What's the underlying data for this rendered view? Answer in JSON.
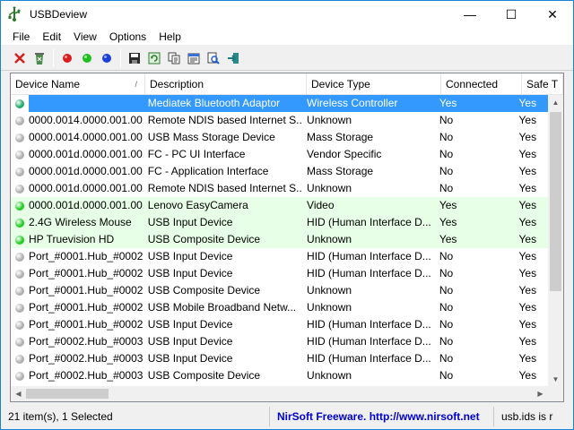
{
  "window": {
    "title": "USBDeview",
    "minimize": "—",
    "maximize": "☐",
    "close": "✕"
  },
  "menu": [
    "File",
    "Edit",
    "View",
    "Options",
    "Help"
  ],
  "columns": [
    {
      "label": "Device Name",
      "sort": "ascending"
    },
    {
      "label": "Description"
    },
    {
      "label": "Device Type"
    },
    {
      "label": "Connected"
    },
    {
      "label": "Safe T"
    }
  ],
  "rows": [
    {
      "name": "",
      "description": "Mediatek Bluetooth Adaptor",
      "type": "Wireless Controller",
      "connected": "Yes",
      "safe": "Yes",
      "status": "selected",
      "dot": "#22aa66"
    },
    {
      "name": "0000.0014.0000.001.00...",
      "description": "Remote NDIS based Internet S...",
      "type": "Unknown",
      "connected": "No",
      "safe": "Yes",
      "status": "normal",
      "dot": "#b0b0b0"
    },
    {
      "name": "0000.0014.0000.001.00...",
      "description": "USB Mass Storage Device",
      "type": "Mass Storage",
      "connected": "No",
      "safe": "Yes",
      "status": "normal",
      "dot": "#b0b0b0"
    },
    {
      "name": "0000.001d.0000.001.00...",
      "description": "FC - PC UI Interface",
      "type": "Vendor Specific",
      "connected": "No",
      "safe": "Yes",
      "status": "normal",
      "dot": "#b0b0b0"
    },
    {
      "name": "0000.001d.0000.001.00...",
      "description": "FC - Application Interface",
      "type": "Mass Storage",
      "connected": "No",
      "safe": "Yes",
      "status": "normal",
      "dot": "#b0b0b0"
    },
    {
      "name": "0000.001d.0000.001.00...",
      "description": "Remote NDIS based Internet S...",
      "type": "Unknown",
      "connected": "No",
      "safe": "Yes",
      "status": "normal",
      "dot": "#b0b0b0"
    },
    {
      "name": "0000.001d.0000.001.00...",
      "description": "Lenovo EasyCamera",
      "type": "Video",
      "connected": "Yes",
      "safe": "Yes",
      "status": "connected",
      "dot": "#22cc22"
    },
    {
      "name": "2.4G Wireless Mouse",
      "description": "USB Input Device",
      "type": "HID (Human Interface D...",
      "connected": "Yes",
      "safe": "Yes",
      "status": "connected",
      "dot": "#22cc22"
    },
    {
      "name": "HP Truevision HD",
      "description": "USB Composite Device",
      "type": "Unknown",
      "connected": "Yes",
      "safe": "Yes",
      "status": "connected",
      "dot": "#22cc22"
    },
    {
      "name": "Port_#0001.Hub_#0002",
      "description": "USB Input Device",
      "type": "HID (Human Interface D...",
      "connected": "No",
      "safe": "Yes",
      "status": "normal",
      "dot": "#b0b0b0"
    },
    {
      "name": "Port_#0001.Hub_#0002",
      "description": "USB Input Device",
      "type": "HID (Human Interface D...",
      "connected": "No",
      "safe": "Yes",
      "status": "normal",
      "dot": "#b0b0b0"
    },
    {
      "name": "Port_#0001.Hub_#0002",
      "description": "USB Composite Device",
      "type": "Unknown",
      "connected": "No",
      "safe": "Yes",
      "status": "normal",
      "dot": "#b0b0b0"
    },
    {
      "name": "Port_#0001.Hub_#0002",
      "description": "USB Mobile Broadband Netw...",
      "type": "Unknown",
      "connected": "No",
      "safe": "Yes",
      "status": "normal",
      "dot": "#b0b0b0"
    },
    {
      "name": "Port_#0001.Hub_#0002",
      "description": "USB Input Device",
      "type": "HID (Human Interface D...",
      "connected": "No",
      "safe": "Yes",
      "status": "normal",
      "dot": "#b0b0b0"
    },
    {
      "name": "Port_#0002.Hub_#0003",
      "description": "USB Input Device",
      "type": "HID (Human Interface D...",
      "connected": "No",
      "safe": "Yes",
      "status": "normal",
      "dot": "#b0b0b0"
    },
    {
      "name": "Port_#0002.Hub_#0003",
      "description": "USB Input Device",
      "type": "HID (Human Interface D...",
      "connected": "No",
      "safe": "Yes",
      "status": "normal",
      "dot": "#b0b0b0"
    },
    {
      "name": "Port_#0002.Hub_#0003",
      "description": "USB Composite Device",
      "type": "Unknown",
      "connected": "No",
      "safe": "Yes",
      "status": "normal",
      "dot": "#b0b0b0"
    }
  ],
  "status": {
    "items": "21 item(s), 1 Selected",
    "link": "NirSoft Freeware.  http://www.nirsoft.net",
    "usbids": "usb.ids is r"
  }
}
